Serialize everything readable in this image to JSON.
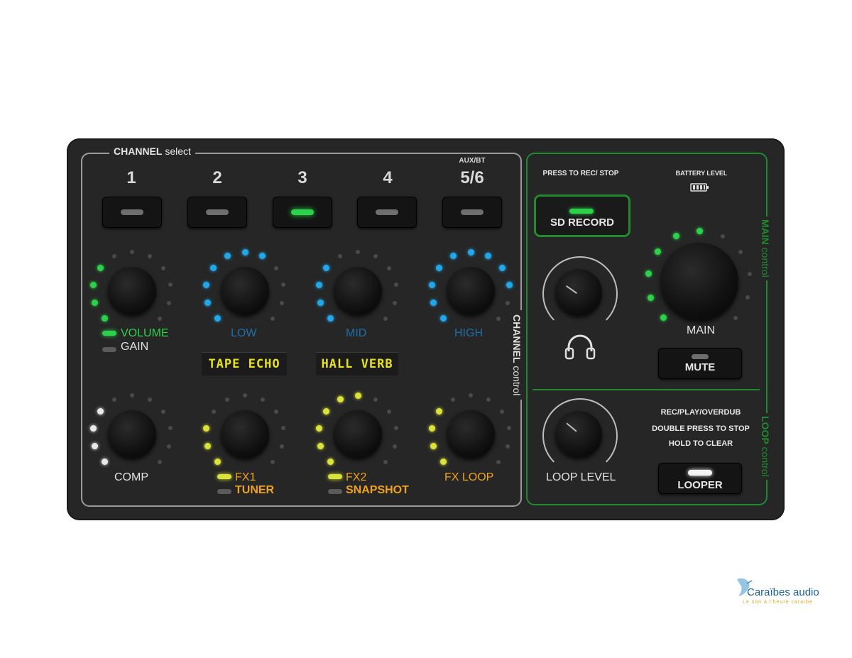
{
  "channel_section": {
    "title_bold": "CHANNEL",
    "title_rest": " select",
    "side_label_bold": "CHANNEL",
    "side_label_rest": " control",
    "channels": [
      {
        "number": "1",
        "superscript": "",
        "active": false
      },
      {
        "number": "2",
        "superscript": "",
        "active": false
      },
      {
        "number": "3",
        "superscript": "",
        "active": true
      },
      {
        "number": "4",
        "superscript": "",
        "active": false
      },
      {
        "number": "5/6",
        "superscript": "AUX/BT",
        "active": false
      }
    ],
    "top_knobs": [
      {
        "label": "VOLUME",
        "sub_label": "GAIN",
        "color": "#2cd14a"
      },
      {
        "label": "LOW",
        "color": "#1f88c9"
      },
      {
        "label": "MID",
        "color": "#1f88c9"
      },
      {
        "label": "HIGH",
        "color": "#1f88c9"
      }
    ],
    "displays": [
      "TAPE ECHO",
      "HALL VERB"
    ],
    "bottom_knobs": [
      {
        "label": "COMP",
        "color": "#e0e0e0"
      },
      {
        "label": "FX1",
        "sub_label": "TUNER",
        "color": "#f0a21a"
      },
      {
        "label": "FX2",
        "sub_label": "SNAPSHOT",
        "color": "#f0a21a"
      },
      {
        "label": "FX LOOP",
        "color": "#f0a21a"
      }
    ]
  },
  "main_section": {
    "press_to_rec": "PRESS TO REC/ STOP",
    "battery_level": "BATTERY LEVEL",
    "sd_record": "SD RECORD",
    "main_label": "MAIN",
    "mute_label": "MUTE",
    "side_label_bold": "MAIN",
    "side_label_rest": " control",
    "headphone_icon": "headphones-icon"
  },
  "loop_section": {
    "loop_level": "LOOP LEVEL",
    "instructions": [
      "REC/PLAY/OVERDUB",
      "DOUBLE PRESS TO STOP",
      "HOLD TO CLEAR"
    ],
    "looper": "LOOPER",
    "side_label_bold": "LOOP",
    "side_label_rest": " control"
  },
  "watermark": {
    "brand": "Caraïbes audio",
    "tagline": "Le son à l'heure caraïbe"
  },
  "colors": {
    "green": "#2cd14a",
    "blue": "#22a7e8",
    "yellow": "#d9e33a",
    "orange": "#f0a21a",
    "border_green": "#1f8a2e"
  }
}
